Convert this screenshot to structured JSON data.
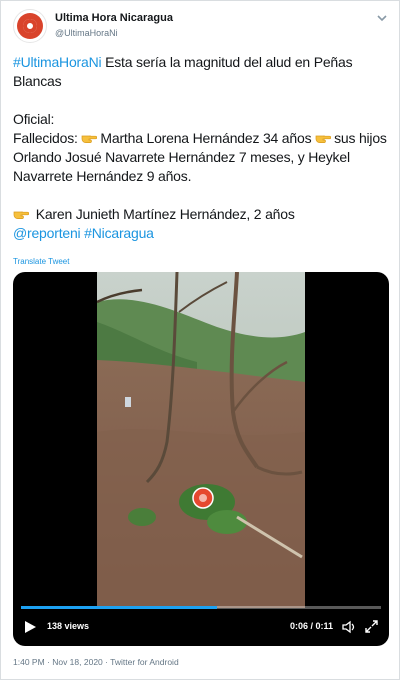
{
  "account": {
    "name": "Ultima Hora Nicaragua",
    "handle": "@UltimaHoraNi"
  },
  "tweet": {
    "line1": {
      "hashtag": "#UltimaHoraNi",
      "text": " Esta sería la magnitud del alud en Peñas Blancas"
    },
    "oficial": "Oficial:",
    "fallecidos_label": "Fallecidos: ",
    "victim1": "Martha Lorena Hernández 34 años ",
    "victims_rest": "sus hijos Orlando Josué Navarrete Hernández 7 meses, y Heykel Navarrete Hernández 9 años.",
    "victim4": " Karen Junieth Martínez Hernández, 2 años",
    "mention": "@reporteni",
    "hashtag2": "#Nicaragua",
    "translate_label": "Translate Tweet"
  },
  "video": {
    "views": "138 views",
    "time": "0:06 / 0:11",
    "progress": 0.545
  },
  "meta": {
    "timestamp": "1:40 PM · Nov 18, 2020 · Twitter for Android"
  },
  "icons": {
    "caret": "chevron-down-icon",
    "emoji": "pointing-hand-emoji",
    "play": "play-icon",
    "volume": "volume-icon",
    "fullscreen": "fullscreen-icon"
  },
  "colors": {
    "link": "#1b95e0",
    "brand": "#d9432b",
    "progress": "#1da1f2"
  }
}
